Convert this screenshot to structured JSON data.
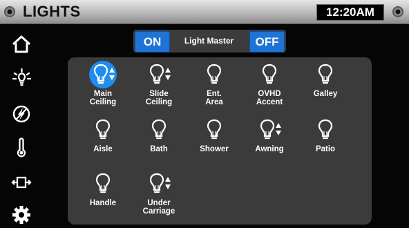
{
  "header": {
    "title": "LIGHTS",
    "time": "12:20AM"
  },
  "sidebar": {
    "items": [
      {
        "icon": "home-icon"
      },
      {
        "icon": "sun-icon"
      },
      {
        "icon": "power-icon"
      },
      {
        "icon": "thermometer-icon"
      },
      {
        "icon": "slide-out-icon"
      },
      {
        "icon": "gear-icon"
      }
    ]
  },
  "master": {
    "on_label": "ON",
    "label": "Light Master",
    "off_label": "OFF",
    "accent": "#1e73d4"
  },
  "lights": [
    {
      "line1": "Main",
      "line2": "Ceiling",
      "dimmable": true,
      "active": true
    },
    {
      "line1": "Slide",
      "line2": "Ceiling",
      "dimmable": true,
      "active": false
    },
    {
      "line1": "Ent.",
      "line2": "Area",
      "dimmable": false,
      "active": false
    },
    {
      "line1": "OVHD",
      "line2": "Accent",
      "dimmable": false,
      "active": false
    },
    {
      "line1": "Galley",
      "line2": "",
      "dimmable": false,
      "active": false
    },
    {
      "line1": "Aisle",
      "line2": "",
      "dimmable": false,
      "active": false
    },
    {
      "line1": "Bath",
      "line2": "",
      "dimmable": false,
      "active": false
    },
    {
      "line1": "Shower",
      "line2": "",
      "dimmable": false,
      "active": false
    },
    {
      "line1": "Awning",
      "line2": "",
      "dimmable": true,
      "active": false
    },
    {
      "line1": "Patio",
      "line2": "",
      "dimmable": false,
      "active": false
    },
    {
      "line1": "Handle",
      "line2": "",
      "dimmable": false,
      "active": false
    },
    {
      "line1": "Under",
      "line2": "Carriage",
      "dimmable": true,
      "active": false
    }
  ]
}
